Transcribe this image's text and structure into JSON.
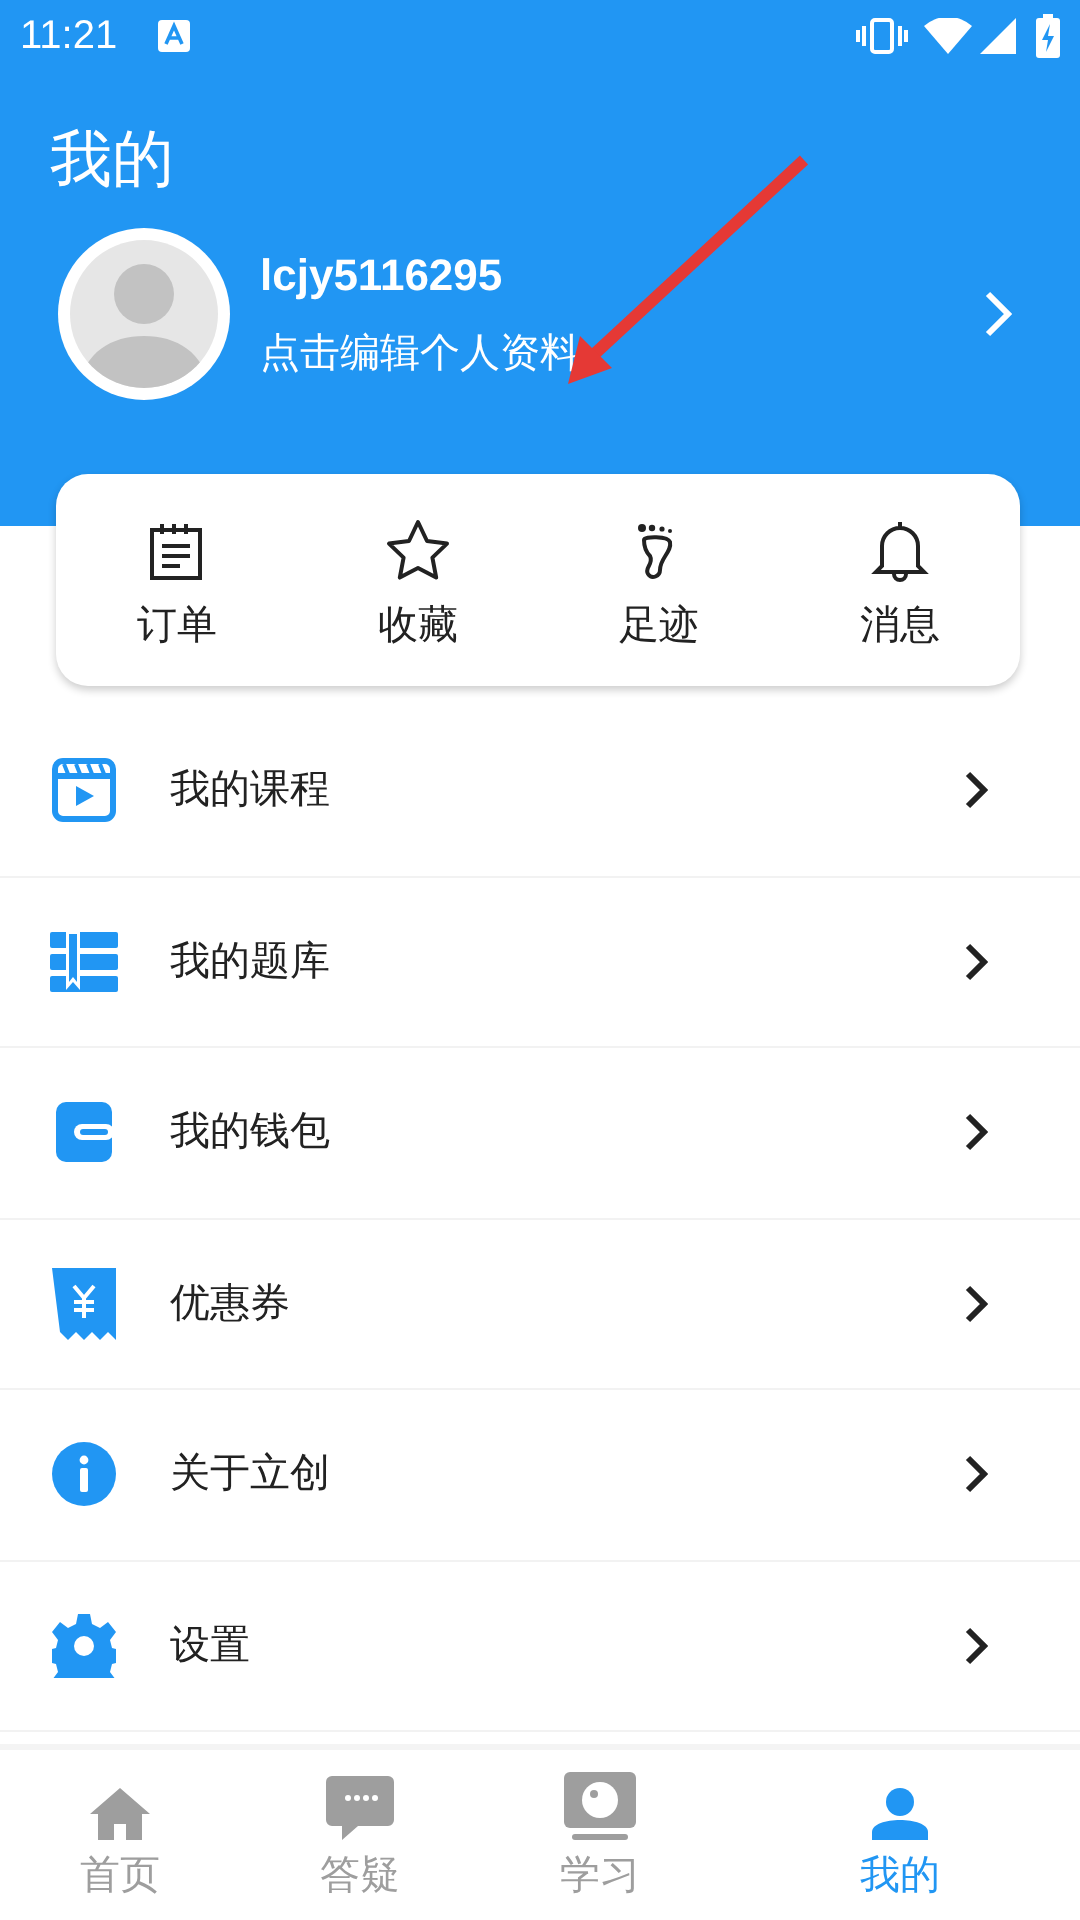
{
  "status_bar": {
    "time": "11:21"
  },
  "header": {
    "title": "我的"
  },
  "profile": {
    "username": "lcjy5116295",
    "subtitle": "点击编辑个人资料"
  },
  "shortcuts": [
    {
      "kind": "orders",
      "label": "订单"
    },
    {
      "kind": "favorites",
      "label": "收藏"
    },
    {
      "kind": "footprints",
      "label": "足迹"
    },
    {
      "kind": "messages",
      "label": "消息"
    }
  ],
  "menu": [
    {
      "kind": "courses",
      "label": "我的课程"
    },
    {
      "kind": "questions",
      "label": "我的题库"
    },
    {
      "kind": "wallet",
      "label": "我的钱包"
    },
    {
      "kind": "coupons",
      "label": "优惠券"
    },
    {
      "kind": "about",
      "label": "关于立创"
    },
    {
      "kind": "settings",
      "label": "设置"
    }
  ],
  "tab_bar": [
    {
      "kind": "home",
      "label": "首页",
      "selected": false
    },
    {
      "kind": "qa",
      "label": "答疑",
      "selected": false
    },
    {
      "kind": "study",
      "label": "学习",
      "selected": false
    },
    {
      "kind": "me",
      "label": "我的",
      "selected": true
    }
  ]
}
